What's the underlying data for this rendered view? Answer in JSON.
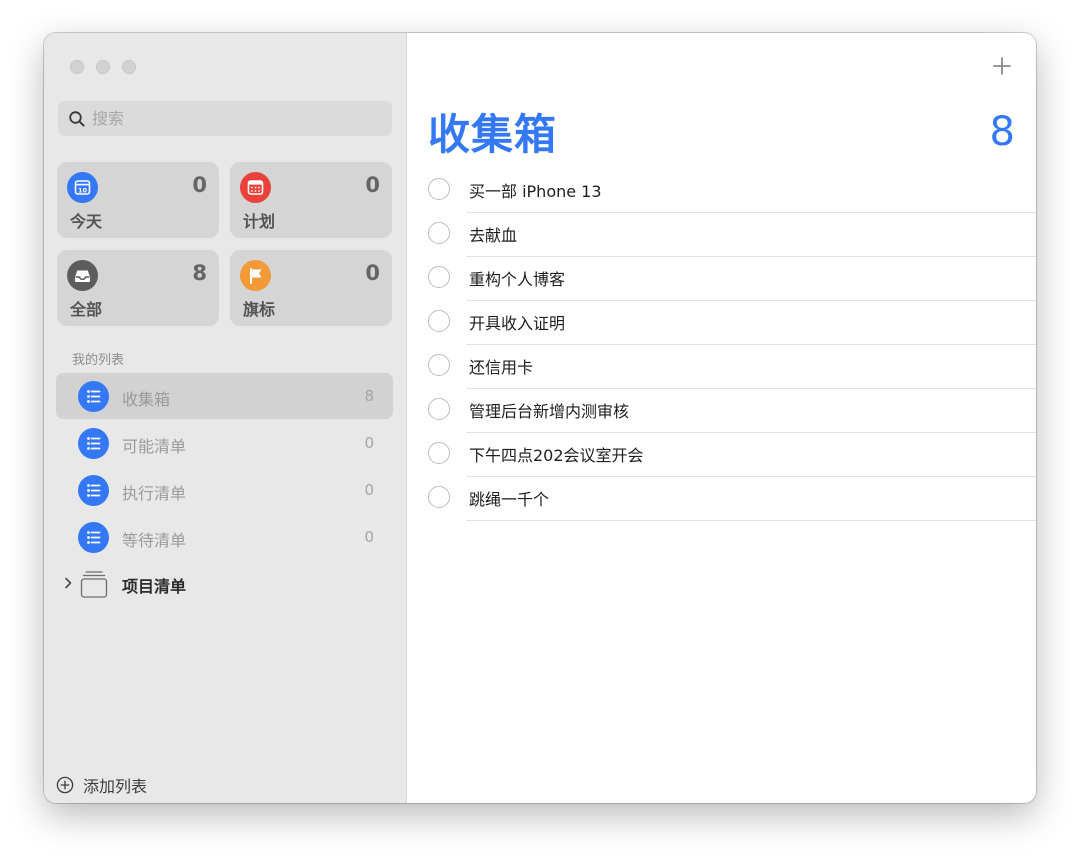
{
  "sidebar": {
    "search": {
      "placeholder": "搜索",
      "value": ""
    },
    "smart_lists": [
      {
        "label": "今天",
        "count": "0",
        "icon": "calendar-today-icon",
        "color": "#3478f6"
      },
      {
        "label": "计划",
        "count": "0",
        "icon": "calendar-scheduled-icon",
        "color": "#e9423a"
      },
      {
        "label": "全部",
        "count": "8",
        "icon": "tray-icon",
        "color": "#5e5c5e"
      },
      {
        "label": "旗标",
        "count": "0",
        "icon": "flag-icon",
        "color": "#f19a37"
      }
    ],
    "section_title": "我的列表",
    "lists": [
      {
        "name": "收集箱",
        "count": "8",
        "icon": "list-bullet-icon",
        "color": "#3478f6",
        "selected": true
      },
      {
        "name": "可能清单",
        "count": "0",
        "icon": "list-bullet-icon",
        "color": "#3478f6",
        "selected": false
      },
      {
        "name": "执行清单",
        "count": "0",
        "icon": "list-bullet-icon",
        "color": "#3478f6",
        "selected": false
      },
      {
        "name": "等待清单",
        "count": "0",
        "icon": "list-bullet-icon",
        "color": "#3478f6",
        "selected": false
      }
    ],
    "group": {
      "name": "项目清单",
      "icon": "folder-stack-icon",
      "expanded": false
    },
    "add_list_label": "添加列表"
  },
  "main": {
    "title": "收集箱",
    "count": "8",
    "accent_color": "#3478f6",
    "reminders": [
      "买一部 iPhone 13",
      "去献血",
      "重构个人博客",
      "开具收入证明",
      "还信用卡",
      "管理后台新增内测审核",
      "下午四点202会议室开会",
      "跳绳一千个"
    ]
  }
}
